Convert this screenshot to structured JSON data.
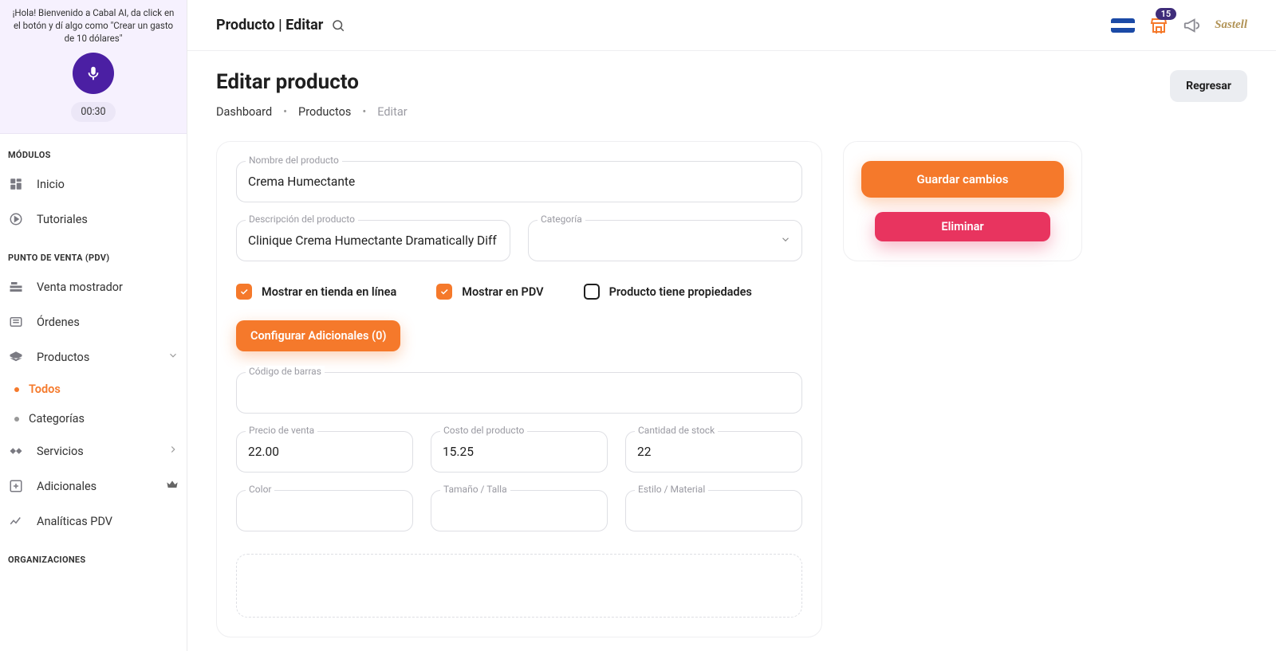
{
  "colors": {
    "accent": "#f5792b",
    "primary_dark": "#4b1fa3",
    "danger": "#e8345f"
  },
  "ai": {
    "welcome": "¡Hola! Bienvenido a Cabal AI, da click en el botón y dí algo como \"Crear un gasto de 10 dólares\"",
    "timer": "00:30"
  },
  "nav": {
    "section_modules": "MÓDULOS",
    "inicio": "Inicio",
    "tutoriales": "Tutoriales",
    "section_pdv": "PUNTO DE VENTA (PDV)",
    "venta_mostrador": "Venta mostrador",
    "ordenes": "Órdenes",
    "productos": "Productos",
    "productos_sub": {
      "todos": "Todos",
      "categorias": "Categorías"
    },
    "servicios": "Servicios",
    "adicionales": "Adicionales",
    "analiticas": "Analíticas PDV",
    "section_org": "ORGANIZACIONES"
  },
  "topbar": {
    "title": "Producto | Editar",
    "badge": "15",
    "brand": "Sastell"
  },
  "header": {
    "h1": "Editar producto",
    "bc": {
      "dashboard": "Dashboard",
      "productos": "Productos",
      "editar": "Editar"
    },
    "back": "Regresar"
  },
  "form": {
    "labels": {
      "nombre": "Nombre del producto",
      "descripcion": "Descripción del producto",
      "categoria": "Categoría",
      "codigo": "Código de barras",
      "precio": "Precio de venta",
      "costo": "Costo del producto",
      "stock": "Cantidad de stock",
      "color": "Color",
      "talla": "Tamaño / Talla",
      "estilo": "Estilo / Material"
    },
    "values": {
      "nombre": "Crema Humectante",
      "descripcion": "Clinique Crema Humectante Dramatically Diff",
      "categoria": "",
      "codigo": "",
      "precio": "22.00",
      "costo": "15.25",
      "stock": "22",
      "color": "",
      "talla": "",
      "estilo": ""
    },
    "checks": {
      "online": {
        "label": "Mostrar en tienda en línea",
        "on": true
      },
      "pdv": {
        "label": "Mostrar en PDV",
        "on": true
      },
      "props": {
        "label": "Producto tiene propiedades",
        "on": false
      }
    },
    "config_additionals": "Configurar Adicionales (0)"
  },
  "actions": {
    "save": "Guardar cambios",
    "delete": "Eliminar"
  }
}
